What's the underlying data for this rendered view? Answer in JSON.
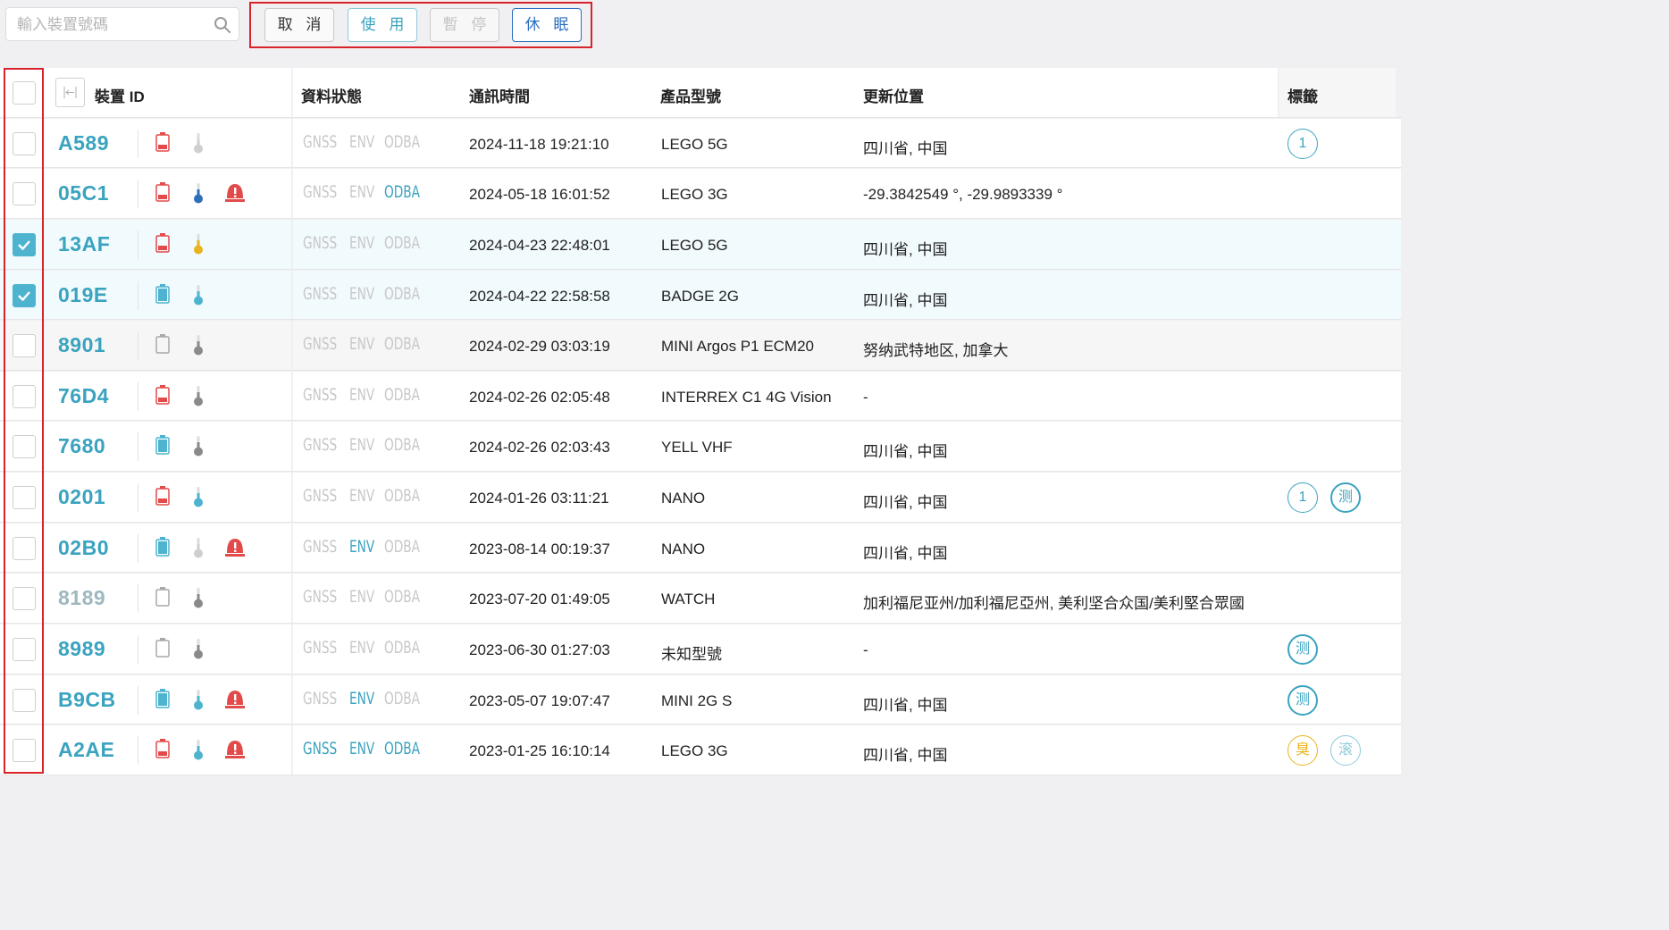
{
  "toolbar": {
    "search_placeholder": "輸入裝置號碼",
    "buttons": {
      "cancel": "取 消",
      "use": "使 用",
      "pause": "暫 停",
      "sleep": "休 眠"
    }
  },
  "table": {
    "headers": {
      "device_id": "裝置 ID",
      "data_status": "資料狀態",
      "comm_time": "通訊時間",
      "model": "產品型號",
      "location": "更新位置",
      "tags": "標籤"
    },
    "status_labels": {
      "gnss": "GNSS",
      "env": "ENV",
      "odba": "ODBA"
    },
    "rows": [
      {
        "id": "A589",
        "checked": false,
        "battery": "red",
        "thermo": "pale",
        "alert": false,
        "gnss": false,
        "env": false,
        "odba": false,
        "time": "2024-11-18 19:21:10",
        "model": "LEGO 5G",
        "location": "四川省, 中国",
        "tags": [
          "1"
        ]
      },
      {
        "id": "05C1",
        "checked": false,
        "battery": "red",
        "thermo": "blue",
        "alert": true,
        "gnss": false,
        "env": false,
        "odba": true,
        "time": "2024-05-18 16:01:52",
        "model": "LEGO 3G",
        "location": "-29.3842549 °, -29.9893339 °",
        "tags": []
      },
      {
        "id": "13AF",
        "checked": true,
        "battery": "red",
        "thermo": "yellow",
        "alert": false,
        "gnss": false,
        "env": false,
        "odba": false,
        "time": "2024-04-23 22:48:01",
        "model": "LEGO 5G",
        "location": "四川省, 中国",
        "tags": []
      },
      {
        "id": "019E",
        "checked": true,
        "battery": "teal",
        "thermo": "teal",
        "alert": false,
        "gnss": false,
        "env": false,
        "odba": false,
        "time": "2024-04-22 22:58:58",
        "model": "BADGE 2G",
        "location": "四川省, 中国",
        "tags": []
      },
      {
        "id": "8901",
        "checked": false,
        "battery": "empty",
        "thermo": "gray",
        "alert": false,
        "gnss": false,
        "env": false,
        "odba": false,
        "time": "2024-02-29 03:03:19",
        "model": "MINI Argos P1 ECM20",
        "location": "努纳武特地区, 加拿大",
        "tags": []
      },
      {
        "id": "76D4",
        "checked": false,
        "battery": "red",
        "thermo": "gray",
        "alert": false,
        "gnss": false,
        "env": false,
        "odba": false,
        "time": "2024-02-26 02:05:48",
        "model": "INTERREX C1 4G Vision",
        "location": "-",
        "tags": []
      },
      {
        "id": "7680",
        "checked": false,
        "battery": "teal",
        "thermo": "gray",
        "alert": false,
        "gnss": false,
        "env": false,
        "odba": false,
        "time": "2024-02-26 02:03:43",
        "model": "YELL VHF",
        "location": "四川省, 中国",
        "tags": []
      },
      {
        "id": "0201",
        "checked": false,
        "battery": "red",
        "thermo": "teal",
        "alert": false,
        "gnss": false,
        "env": false,
        "odba": false,
        "time": "2024-01-26 03:11:21",
        "model": "NANO",
        "location": "四川省, 中国",
        "tags": [
          "1",
          "测"
        ]
      },
      {
        "id": "02B0",
        "checked": false,
        "battery": "teal",
        "thermo": "pale",
        "alert": true,
        "gnss": false,
        "env": true,
        "odba": false,
        "time": "2023-08-14 00:19:37",
        "model": "NANO",
        "location": "四川省, 中国",
        "tags": []
      },
      {
        "id": "8189",
        "checked": false,
        "battery": "empty",
        "thermo": "gray",
        "alert": false,
        "gnss": false,
        "env": false,
        "odba": false,
        "time": "2023-07-20 01:49:05",
        "model": "WATCH",
        "location": "加利福尼亚州/加利福尼亞州, 美利坚合众国/美利堅合眾國",
        "tags": []
      },
      {
        "id": "8989",
        "checked": false,
        "battery": "empty",
        "thermo": "gray",
        "alert": false,
        "gnss": false,
        "env": false,
        "odba": false,
        "time": "2023-06-30 01:27:03",
        "model": "未知型號",
        "location": "-",
        "tags": [
          "测"
        ]
      },
      {
        "id": "B9CB",
        "checked": false,
        "battery": "teal",
        "thermo": "teal",
        "alert": true,
        "gnss": false,
        "env": true,
        "odba": false,
        "time": "2023-05-07 19:07:47",
        "model": "MINI 2G S",
        "location": "四川省, 中国",
        "tags": [
          "测"
        ]
      },
      {
        "id": "A2AE",
        "checked": false,
        "battery": "red",
        "thermo": "teal",
        "alert": true,
        "gnss": true,
        "env": true,
        "odba": true,
        "time": "2023-01-25 16:10:14",
        "model": "LEGO 3G",
        "location": "四川省, 中国",
        "tags": [
          "臭",
          "滚"
        ]
      }
    ]
  },
  "colors": {
    "accent": "#3aa3bf",
    "battery_red": "#e34b4b",
    "battery_teal": "#4db3cf",
    "thermo_blue": "#2f6fb8",
    "thermo_yellow": "#e8b41d",
    "alert_red": "#e34b4b",
    "highlight_red": "#d8232a",
    "selected_row_bg": "#f1fafd"
  }
}
